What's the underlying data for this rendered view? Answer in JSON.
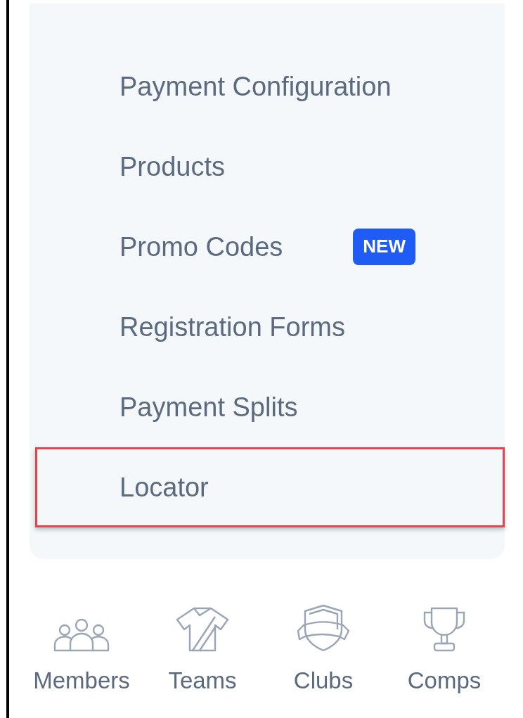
{
  "menu": {
    "items": [
      {
        "label": "Payment Configuration",
        "highlighted": false
      },
      {
        "label": "Products",
        "highlighted": false
      },
      {
        "label": "Promo Codes",
        "badge": "NEW",
        "highlighted": false
      },
      {
        "label": "Registration Forms",
        "highlighted": false
      },
      {
        "label": "Payment Splits",
        "highlighted": false
      },
      {
        "label": "Locator",
        "highlighted": true
      }
    ]
  },
  "bottom_nav": [
    {
      "kind": "members",
      "label": "Members"
    },
    {
      "kind": "teams",
      "label": "Teams"
    },
    {
      "kind": "clubs",
      "label": "Clubs"
    },
    {
      "kind": "comps",
      "label": "Comps"
    }
  ]
}
